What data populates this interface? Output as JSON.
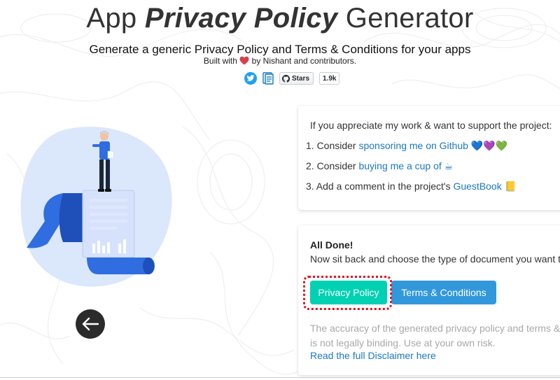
{
  "header": {
    "title_prefix": "App",
    "title_emphasis": "Privacy Policy",
    "title_suffix": "Generator",
    "subtitle": "Generate a generic Privacy Policy and Terms & Conditions for your apps",
    "built_prefix": "Built with",
    "built_suffix": "by Nishant and contributors."
  },
  "socials": {
    "github_label": "Stars",
    "stars_count": "1.9k"
  },
  "support": {
    "heading": "If you appreciate my work & want to support the project:",
    "items": [
      {
        "prefix": "1. Consider ",
        "link": "sponsoring me on Github 💙💜💚"
      },
      {
        "prefix": "2. Consider ",
        "link": "buying me a cup of ☕"
      },
      {
        "prefix": "3. Add a comment in the project's ",
        "link": "GuestBook 📒"
      }
    ]
  },
  "done": {
    "heading": "All Done!",
    "description": "Now sit back and choose the type of document you want to generate.",
    "privacy_policy_button": "Privacy Policy",
    "terms_button": "Terms & Conditions",
    "disclaimer_line1": "The accuracy of the generated privacy policy and terms & conditions",
    "disclaimer_line2": "is not legally binding. Use at your own risk.",
    "disclaimer_link": "Read the full Disclaimer here"
  },
  "colors": {
    "primary_button": "#00d1b2",
    "info_button": "#3298dc",
    "link": "#1a78c2",
    "danger_link": "#e0243a",
    "highlight": "#e0101e"
  }
}
